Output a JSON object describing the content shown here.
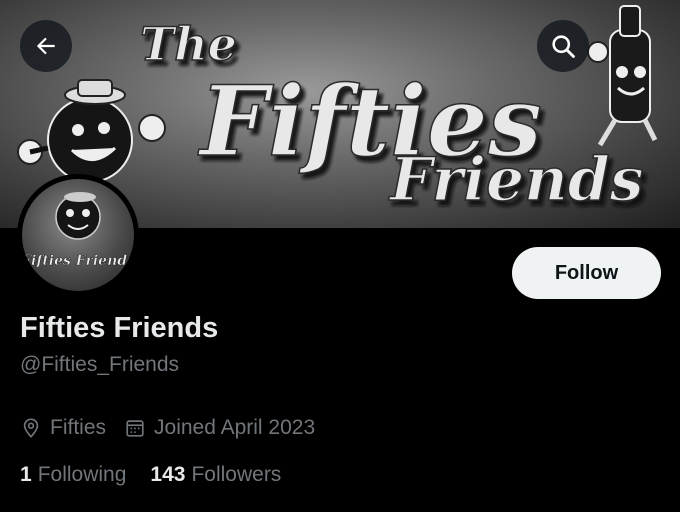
{
  "banner": {
    "title_line1": "The",
    "title_line2": "Fifties",
    "title_line3": "Friends"
  },
  "header": {
    "back_icon": "arrow-left-icon",
    "search_icon": "search-icon"
  },
  "avatar": {
    "text": "Fifties Friends"
  },
  "profile": {
    "follow_label": "Follow",
    "display_name": "Fifties Friends",
    "handle": "@Fifties_Friends",
    "location": "Fifties",
    "joined": "Joined April 2023",
    "following_count": "1",
    "following_label": "Following",
    "followers_count": "143",
    "followers_label": "Followers"
  },
  "colors": {
    "background": "#000000",
    "text_primary": "#e7e9ea",
    "text_secondary": "#71767b",
    "follow_bg": "#eff3f4"
  }
}
